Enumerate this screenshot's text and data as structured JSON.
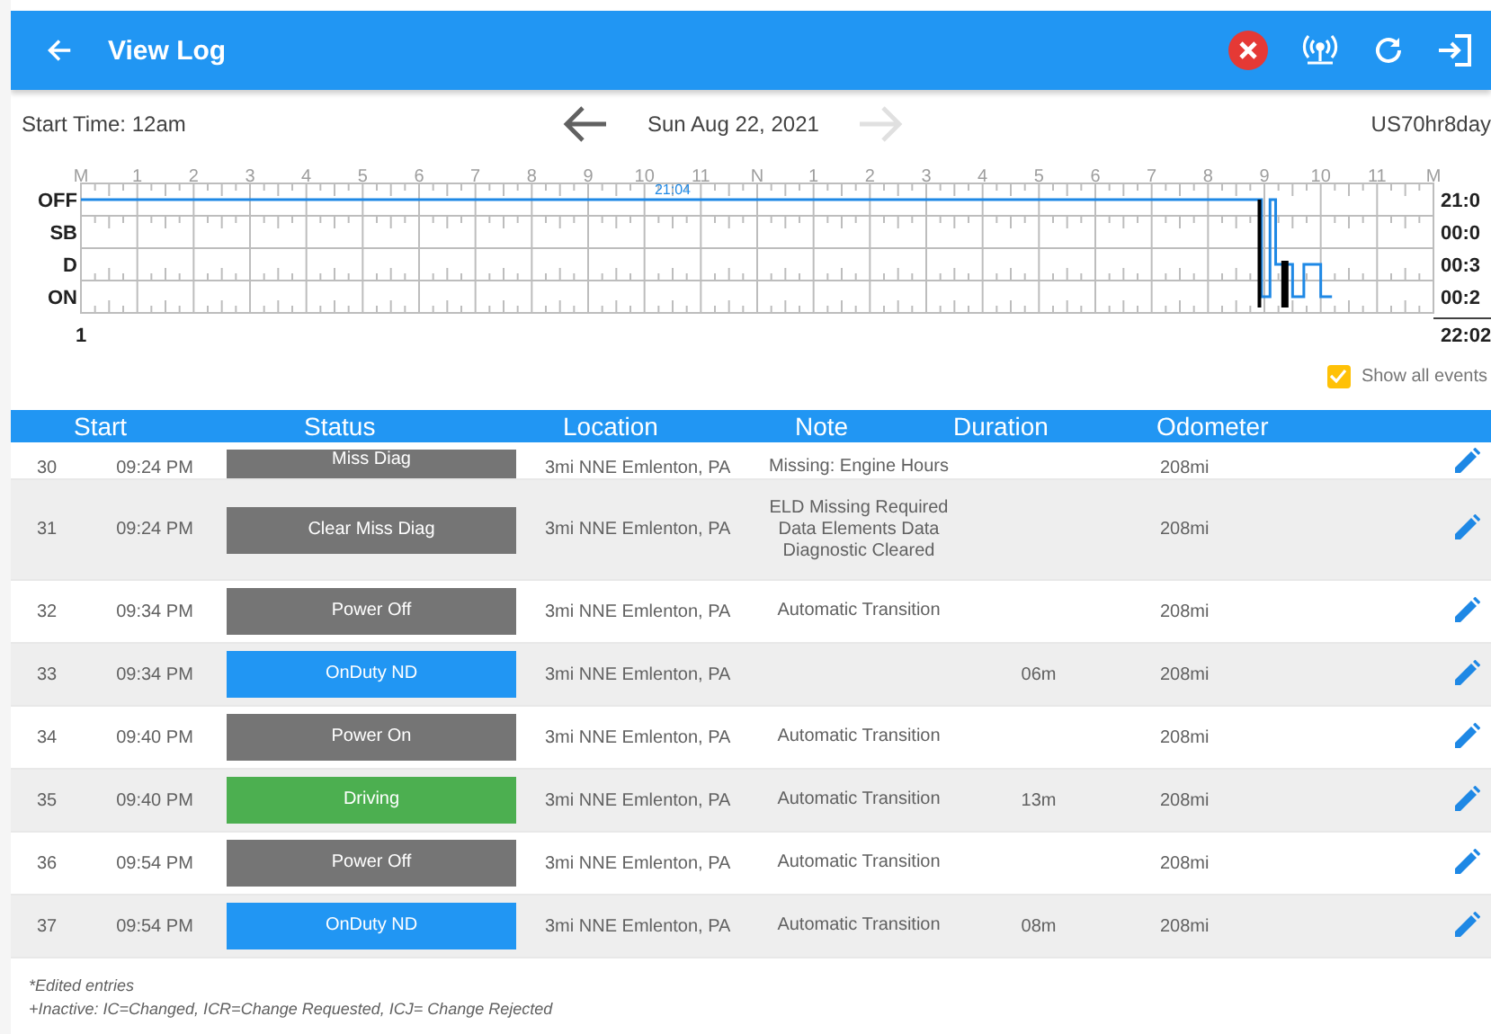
{
  "app_bar": {
    "title": "View Log"
  },
  "date_bar": {
    "start_time": "Start Time: 12am",
    "date": "Sun Aug 22, 2021",
    "next_disabled": true,
    "ruleset": "US70hr8day"
  },
  "graph": {
    "hour_labels": [
      "M",
      "1",
      "2",
      "3",
      "4",
      "5",
      "6",
      "7",
      "8",
      "9",
      "10",
      "11",
      "N",
      "1",
      "2",
      "3",
      "4",
      "5",
      "6",
      "7",
      "8",
      "9",
      "10",
      "11",
      "M"
    ],
    "rows": [
      {
        "label": "OFF",
        "total": "21:0"
      },
      {
        "label": "SB",
        "total": "00:0"
      },
      {
        "label": "D",
        "total": "00:3"
      },
      {
        "label": "ON",
        "total": "00:2"
      }
    ],
    "marker": "21:04",
    "start_label": "1",
    "grand_total": "22:02"
  },
  "show_all_events": {
    "label": "Show all events",
    "checked": true
  },
  "table": {
    "columns": [
      "Start",
      "Status",
      "Location",
      "Note",
      "Duration",
      "Odometer"
    ],
    "rows": [
      {
        "number": "30",
        "start": "09:24 PM",
        "status": "Miss Diag",
        "color": "#757575",
        "location": "3mi NNE Emlenton, PA",
        "note": "Missing: Engine Hours",
        "duration": "",
        "odometer": "208mi",
        "cut_off": true
      },
      {
        "number": "31",
        "start": "09:24 PM",
        "status": "Clear Miss Diag",
        "color": "#757575",
        "location": "3mi NNE Emlenton, PA",
        "note": "ELD Missing Required Data Elements Data Diagnostic Cleared",
        "duration": "",
        "odometer": "208mi",
        "cut_off": false
      },
      {
        "number": "32",
        "start": "09:34 PM",
        "status": "Power Off",
        "color": "#757575",
        "location": "3mi NNE Emlenton, PA",
        "note": "Automatic Transition",
        "duration": "",
        "odometer": "208mi",
        "cut_off": false
      },
      {
        "number": "33",
        "start": "09:34 PM",
        "status": "OnDuty ND",
        "color": "#2196f3",
        "location": "3mi NNE Emlenton, PA",
        "note": "",
        "duration": "06m",
        "odometer": "208mi",
        "cut_off": false
      },
      {
        "number": "34",
        "start": "09:40 PM",
        "status": "Power On",
        "color": "#757575",
        "location": "3mi NNE Emlenton, PA",
        "note": "Automatic Transition",
        "duration": "",
        "odometer": "208mi",
        "cut_off": false
      },
      {
        "number": "35",
        "start": "09:40 PM",
        "status": "Driving",
        "color": "#4caf50",
        "location": "3mi NNE Emlenton, PA",
        "note": "Automatic Transition",
        "duration": "13m",
        "odometer": "208mi",
        "cut_off": false
      },
      {
        "number": "36",
        "start": "09:54 PM",
        "status": "Power Off",
        "color": "#757575",
        "location": "3mi NNE Emlenton, PA",
        "note": "Automatic Transition",
        "duration": "",
        "odometer": "208mi",
        "cut_off": false
      },
      {
        "number": "37",
        "start": "09:54 PM",
        "status": "OnDuty ND",
        "color": "#2196f3",
        "location": "3mi NNE Emlenton, PA",
        "note": "Automatic Transition",
        "duration": "08m",
        "odometer": "208mi",
        "cut_off": false
      }
    ]
  },
  "footnotes": [
    "*Edited entries",
    "+Inactive: IC=Changed, ICR=Change Requested, ICJ= Change Rejected"
  ]
}
